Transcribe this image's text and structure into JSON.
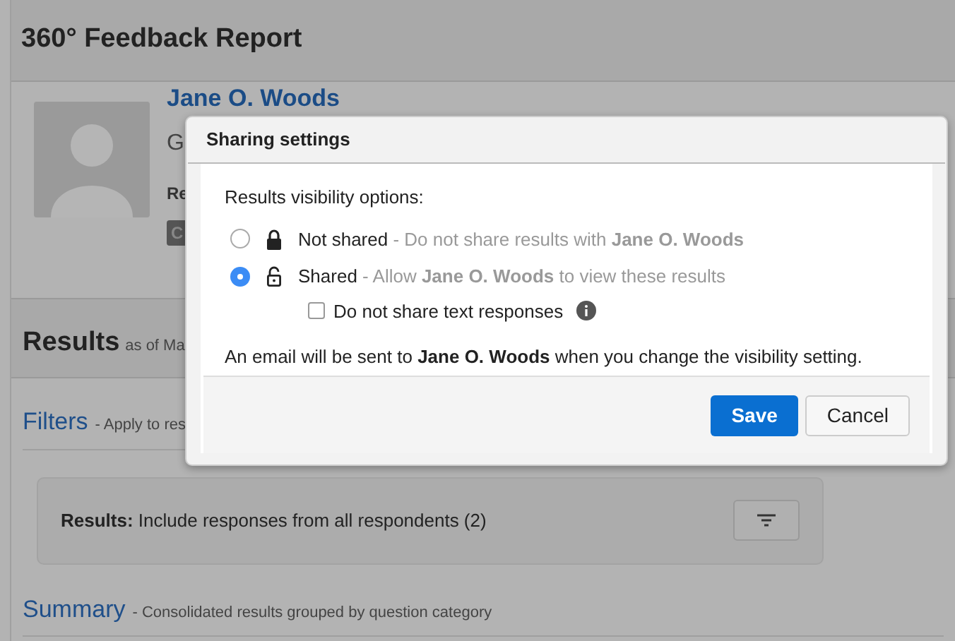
{
  "page": {
    "title": "360° Feedback Report"
  },
  "profile": {
    "name": "Jane O. Woods",
    "line_2": "G",
    "line_3": "Re",
    "badge": "C"
  },
  "results": {
    "title": "Results",
    "subtitle": "as of Ma"
  },
  "filters": {
    "title": "Filters",
    "subtitle": "- Apply to res",
    "label": "Results:",
    "text": "Include responses from all respondents (2)"
  },
  "summary": {
    "title": "Summary",
    "subtitle": "- Consolidated results grouped by question category"
  },
  "dialog": {
    "title": "Sharing settings",
    "intro": "Results visibility options:",
    "options": [
      {
        "label": "Not shared",
        "description": "- Do not share results with **Jane O. Woods**",
        "locked": true,
        "selected": false
      },
      {
        "label": "Shared",
        "description": "- Allow **Jane O. Woods** to view these results",
        "locked": false,
        "selected": true
      }
    ],
    "checkbox": {
      "label": "Do not share text responses",
      "checked": false
    },
    "note": "An email will be sent to **Jane O. Woods** when you change the visibility setting.",
    "buttons": [
      {
        "label": "Save",
        "kind": "primary"
      },
      {
        "label": "Cancel",
        "kind": "secondary"
      }
    ]
  }
}
